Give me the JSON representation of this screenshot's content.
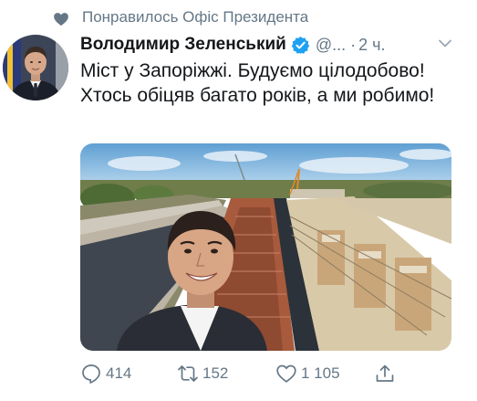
{
  "social_context": {
    "text": "Понравилось Офіс Президента",
    "icon": "heart-icon"
  },
  "tweet": {
    "author_name": "Володимир Зеленський",
    "handle": "@...",
    "separator": "·",
    "time": "2 ч.",
    "text": "Міст у Запоріжжі. Будуємо цілодобово!\nХтось обіцяв багато років, а ми робимо!",
    "verified_icon": "verified-badge-icon",
    "menu_icon": "chevron-down-icon"
  },
  "actions": {
    "reply_count": "414",
    "retweet_count": "152",
    "like_count": "1 105",
    "reply_icon": "reply-icon",
    "retweet_icon": "retweet-icon",
    "like_icon": "heart-icon",
    "share_icon": "share-icon"
  },
  "colors": {
    "muted": "#657786",
    "text": "#14171a",
    "verified": "#1da1f2",
    "icon": "#657786"
  }
}
